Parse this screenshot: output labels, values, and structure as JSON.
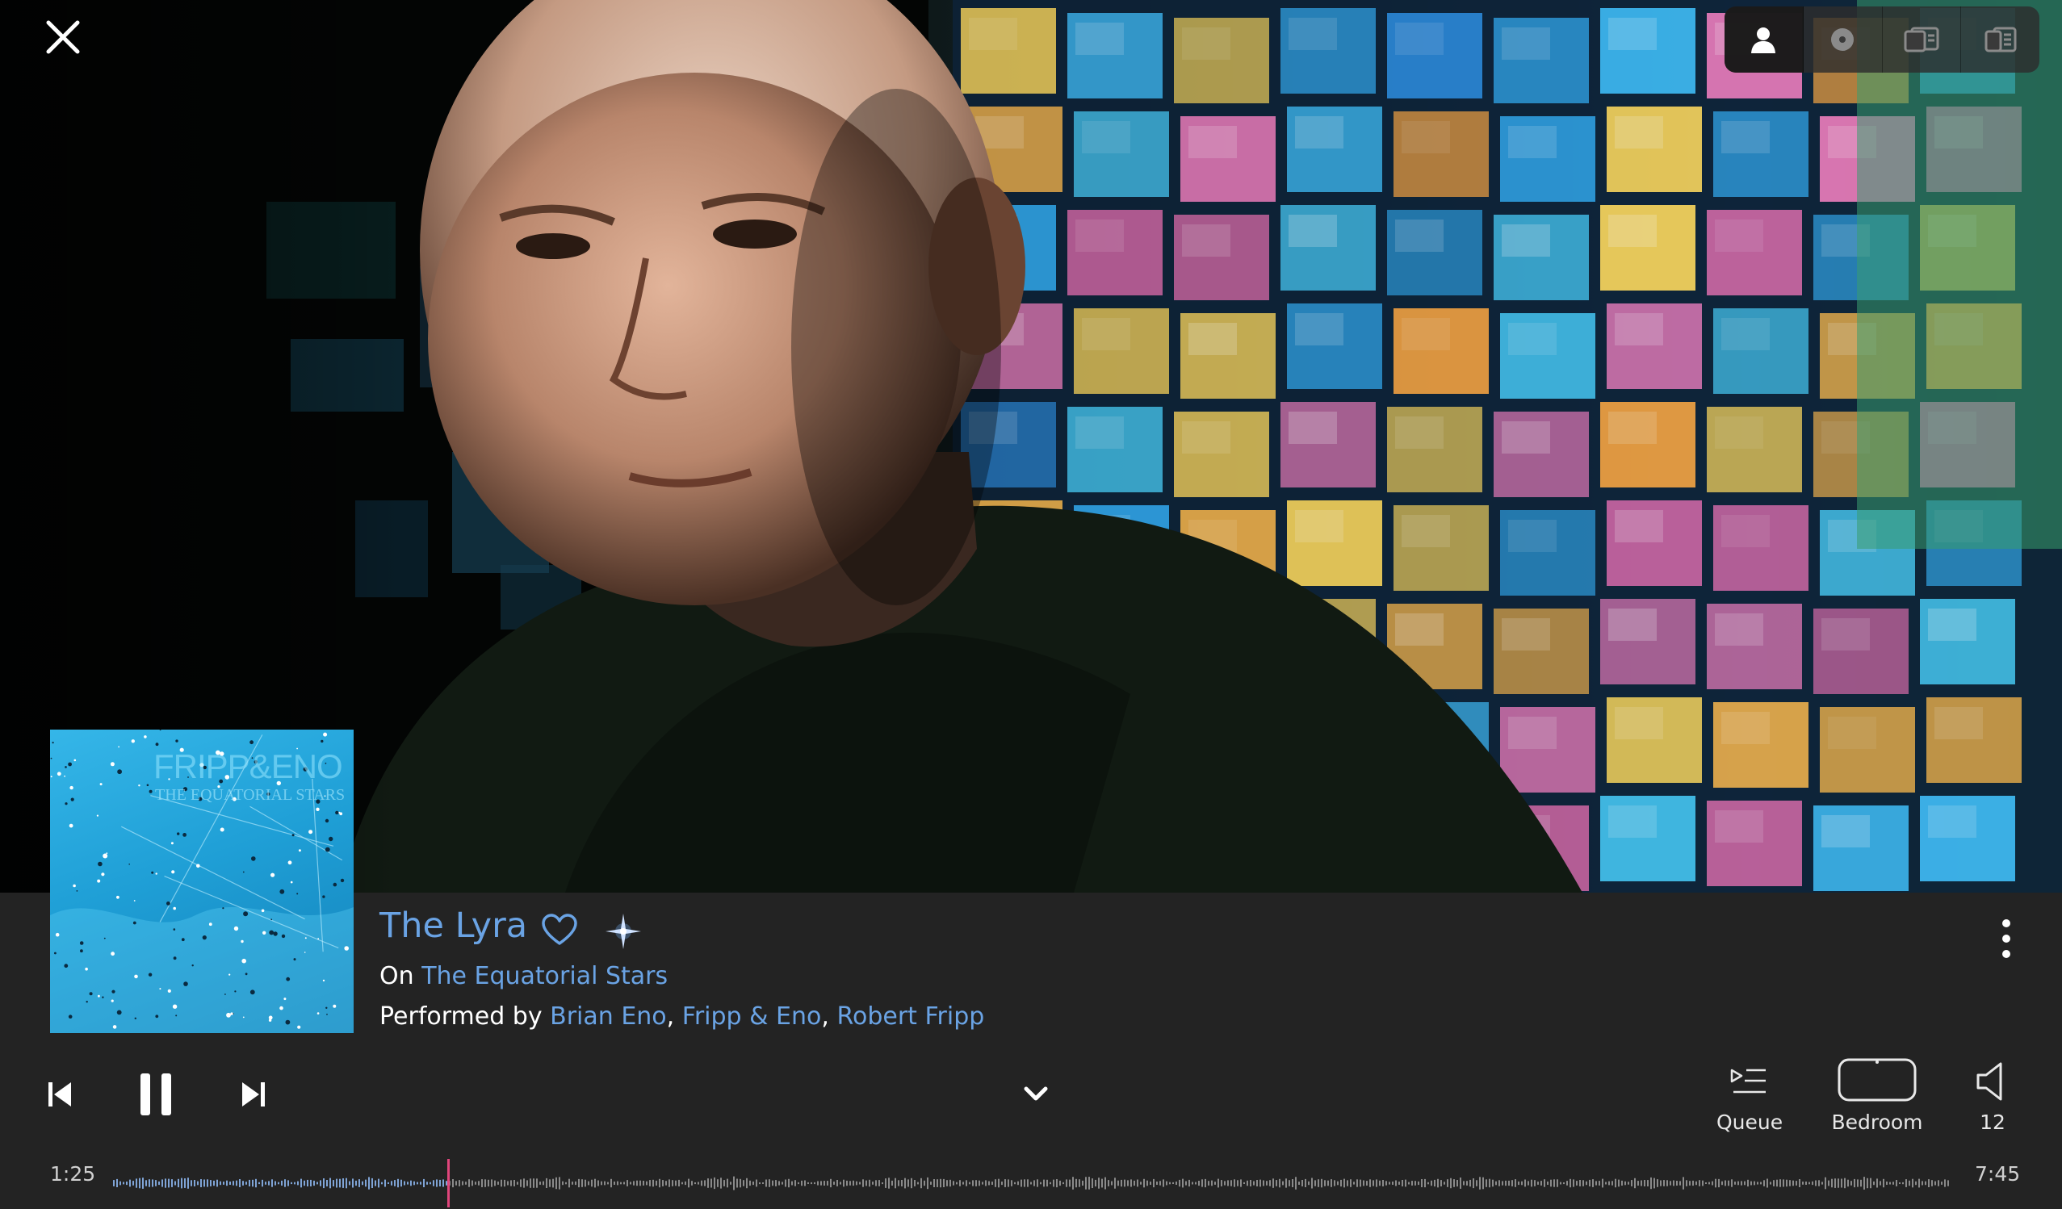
{
  "top_controls": {
    "close_icon": "close-icon",
    "view_tabs": [
      {
        "name": "artist",
        "icon": "person-icon",
        "active": true
      },
      {
        "name": "album",
        "icon": "disc-icon",
        "active": false
      },
      {
        "name": "info",
        "icon": "card-icon",
        "active": false
      },
      {
        "name": "lyrics",
        "icon": "document-icon",
        "active": false
      }
    ]
  },
  "album_art": {
    "title": "FRIPP&ENO",
    "subtitle": "THE EQUATORIAL STARS"
  },
  "track": {
    "title": "The Lyra",
    "on_prefix": "On",
    "album": "The Equatorial Stars",
    "performed_prefix": "Performed by",
    "performers": [
      "Brian Eno",
      "Fripp & Eno",
      "Robert Fripp"
    ],
    "separator": ","
  },
  "controls": {
    "queue_label": "Queue",
    "room_label": "Bedroom",
    "volume": "12"
  },
  "playback": {
    "elapsed": "1:25",
    "duration": "7:45",
    "progress_fraction": 0.182,
    "state": "playing"
  },
  "colors": {
    "accent": "#6aa3e4",
    "panel_bg": "#232323",
    "playhead": "#e0457b",
    "played_wave": "#7fa4d6",
    "unplayed_wave": "#8a8a8a"
  }
}
